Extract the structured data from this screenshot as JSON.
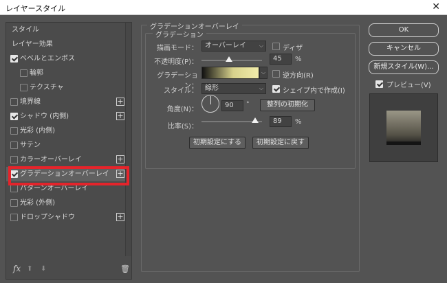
{
  "window": {
    "title": "レイヤースタイル",
    "close_glyph": "✕"
  },
  "left": {
    "items": [
      {
        "label": "スタイル",
        "type": "header",
        "checked": null,
        "plus": false
      },
      {
        "label": "レイヤー効果",
        "type": "header",
        "checked": null,
        "plus": false
      },
      {
        "label": "ベベルとエンボス",
        "type": "item",
        "checked": true,
        "plus": false
      },
      {
        "label": "輪郭",
        "type": "indent",
        "checked": false,
        "plus": false
      },
      {
        "label": "テクスチャ",
        "type": "indent",
        "checked": false,
        "plus": false
      },
      {
        "label": "境界線",
        "type": "item",
        "checked": false,
        "plus": true
      },
      {
        "label": "シャドウ (内側)",
        "type": "item",
        "checked": true,
        "plus": true
      },
      {
        "label": "光彩 (内側)",
        "type": "item",
        "checked": false,
        "plus": false
      },
      {
        "label": "サテン",
        "type": "item",
        "checked": false,
        "plus": false
      },
      {
        "label": "カラーオーバーレイ",
        "type": "item",
        "checked": false,
        "plus": true
      },
      {
        "label": "グラデーションオーバーレイ",
        "type": "item",
        "checked": true,
        "plus": true,
        "selected": true
      },
      {
        "label": "パターンオーバーレイ",
        "type": "item",
        "checked": false,
        "plus": false
      },
      {
        "label": "光彩 (外側)",
        "type": "item",
        "checked": false,
        "plus": false
      },
      {
        "label": "ドロップシャドウ",
        "type": "item",
        "checked": false,
        "plus": true
      }
    ],
    "footer": {
      "fx": "fx",
      "up": "⬆",
      "down": "⬇",
      "trash": "🗑"
    }
  },
  "panel": {
    "group_title": "グラデーションオーバーレイ",
    "sub_title": "グラデーション",
    "blend_mode": {
      "label": "描画モード：",
      "value": "オーバーレイ"
    },
    "dither": {
      "label": "ディザ",
      "checked": false
    },
    "opacity": {
      "label": "不透明度(P)：",
      "value": "45",
      "unit": "%",
      "level": 0.45
    },
    "gradient": {
      "label": "グラデーション：",
      "colors": [
        "#111111",
        "#d8d28c",
        "#f1ecaa"
      ]
    },
    "reverse": {
      "label": "逆方向(R)",
      "checked": false
    },
    "style": {
      "label": "スタイル：",
      "value": "線形"
    },
    "align_layer": {
      "label": "シェイプ内で作成(I)",
      "checked": true
    },
    "angle": {
      "label": "角度(N)：",
      "value": "90",
      "unit": "°"
    },
    "reset_align_button": "整列の初期化",
    "scale": {
      "label": "比率(S)：",
      "value": "89",
      "unit": "%",
      "level": 0.89
    },
    "make_default_button": "初期設定にする",
    "reset_default_button": "初期設定に戻す"
  },
  "right": {
    "ok": "OK",
    "cancel": "キャンセル",
    "new_style": "新規スタイル(W)...",
    "preview": {
      "label": "プレビュー(V)",
      "checked": true
    }
  },
  "colors": {
    "highlight": "#e5242b",
    "bg": "#535353"
  }
}
